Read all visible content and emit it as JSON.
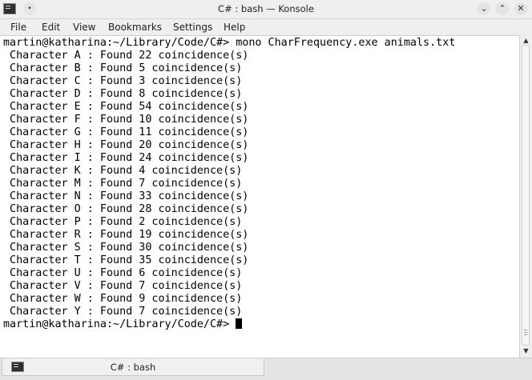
{
  "window": {
    "title": "C# : bash — Konsole",
    "controls": {
      "minimize": "⌄",
      "maximize": "⌃",
      "close": "✕"
    }
  },
  "menu": [
    "File",
    "Edit",
    "View",
    "Bookmarks",
    "Settings",
    "Help"
  ],
  "terminal": {
    "lines": [
      "martin@katharina:~/Library/Code/C#> mono CharFrequency.exe animals.txt",
      " Character A : Found 22 coincidence(s)",
      " Character B : Found 5 coincidence(s)",
      " Character C : Found 3 coincidence(s)",
      " Character D : Found 8 coincidence(s)",
      " Character E : Found 54 coincidence(s)",
      " Character F : Found 10 coincidence(s)",
      " Character G : Found 11 coincidence(s)",
      " Character H : Found 20 coincidence(s)",
      " Character I : Found 24 coincidence(s)",
      " Character K : Found 4 coincidence(s)",
      " Character M : Found 7 coincidence(s)",
      " Character N : Found 33 coincidence(s)",
      " Character O : Found 28 coincidence(s)",
      " Character P : Found 2 coincidence(s)",
      " Character R : Found 19 coincidence(s)",
      " Character S : Found 30 coincidence(s)",
      " Character T : Found 35 coincidence(s)",
      " Character U : Found 6 coincidence(s)",
      " Character V : Found 7 coincidence(s)",
      " Character W : Found 9 coincidence(s)",
      " Character Y : Found 7 coincidence(s)"
    ],
    "prompt": "martin@katharina:~/Library/Code/C#> "
  },
  "tabs": [
    {
      "label": "C# : bash",
      "icon": "terminal-icon"
    }
  ]
}
